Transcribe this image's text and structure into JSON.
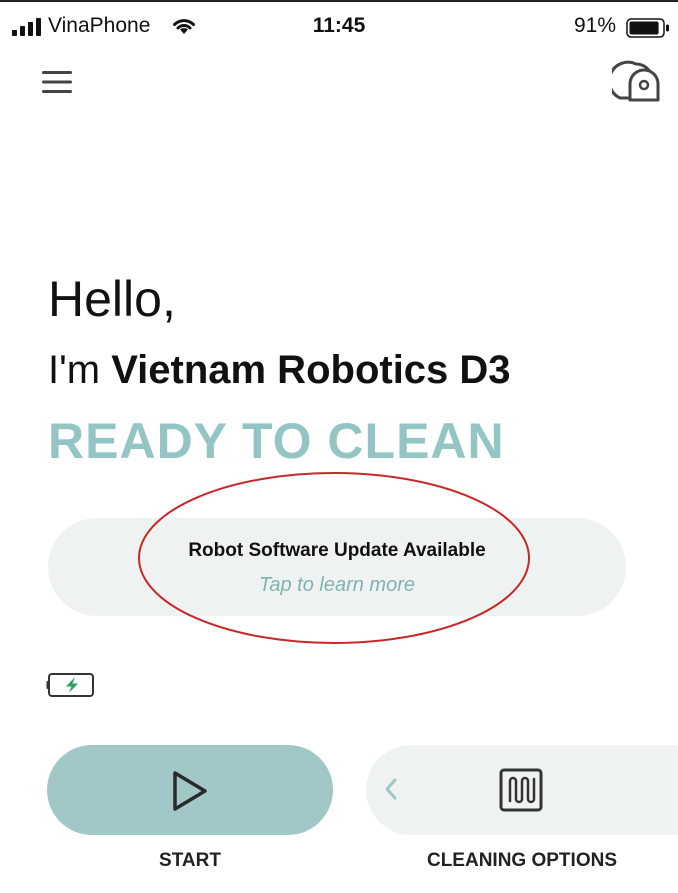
{
  "status_bar": {
    "carrier": "VinaPhone",
    "time": "11:45",
    "battery_percent": "91%",
    "signal_bars": 4,
    "battery_level": 0.91
  },
  "header": {
    "menu_icon": "hamburger-menu-icon",
    "robot_icon": "robot-vacuum-icon"
  },
  "greeting": {
    "hello": "Hello,",
    "im_prefix": "I'm ",
    "robot_name": "Vietnam Robotics D3",
    "status": "READY TO CLEAN"
  },
  "update_banner": {
    "title": "Robot Software Update Available",
    "subtitle": "Tap to learn more"
  },
  "robot_battery": {
    "icon": "battery-charging-icon"
  },
  "actions": {
    "start_label": "START",
    "options_label": "CLEANING OPTIONS"
  },
  "colors": {
    "accent": "#93c5c4",
    "start_button": "#a1c7c6",
    "pill_background": "#eef3f2",
    "subtitle": "#7fb3b2",
    "annotation": "#c62828",
    "battery_green": "#2e9e5b"
  }
}
